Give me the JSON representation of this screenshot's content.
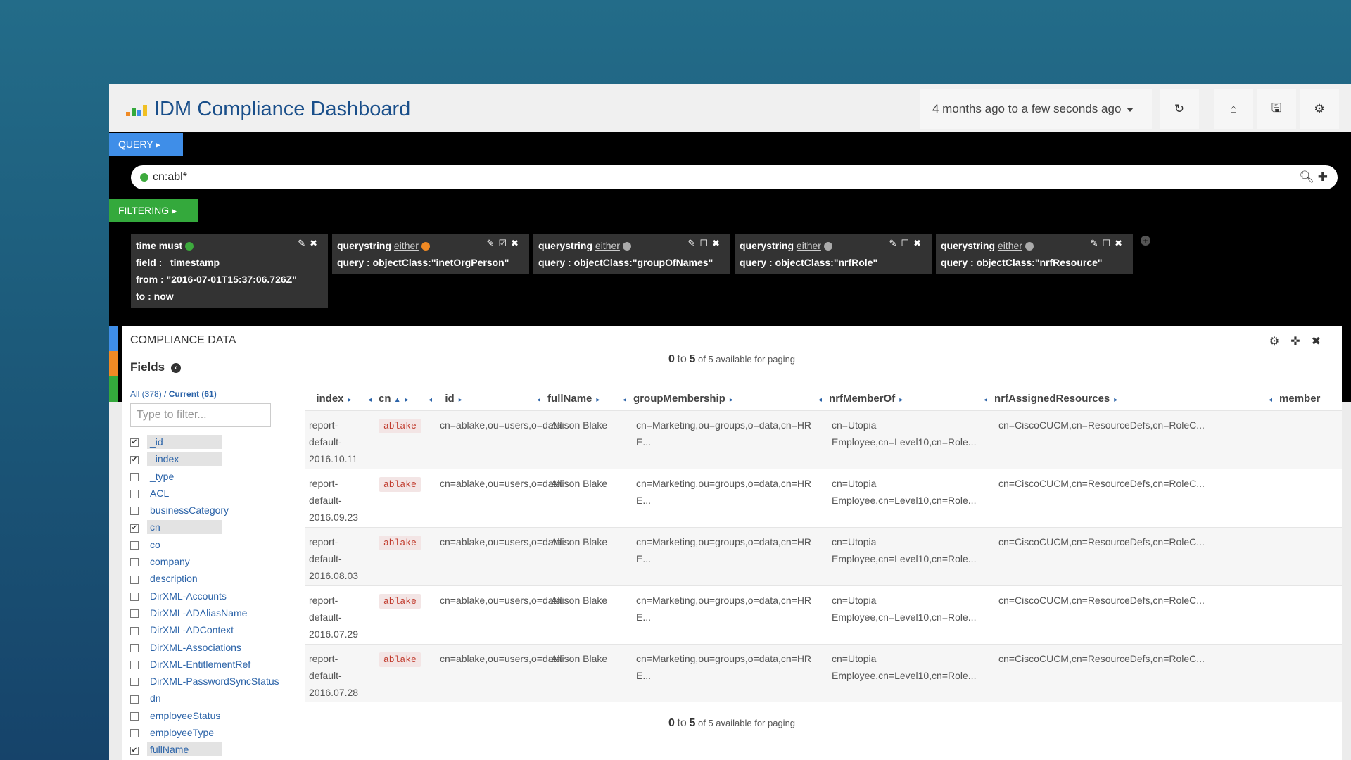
{
  "header": {
    "title": "IDM Compliance Dashboard",
    "time_range": "4 months ago to a few seconds ago"
  },
  "query": {
    "tab_label": "QUERY",
    "value": "cn:abl*"
  },
  "filtering": {
    "tab_label": "FILTERING",
    "filters": [
      {
        "type": "time",
        "mode": "must",
        "dot_color": "#3daa3d",
        "lines": [
          "field : _timestamp",
          "from : \"2016-07-01T15:37:06.726Z\"",
          "to : now"
        ]
      },
      {
        "type": "querystring",
        "mode": "either",
        "dot_color": "#f08a24",
        "lines": [
          "query : objectClass:\"inetOrgPerson\""
        ]
      },
      {
        "type": "querystring",
        "mode": "either",
        "dot_color": "#aaaaaa",
        "lines": [
          "query : objectClass:\"groupOfNames\""
        ]
      },
      {
        "type": "querystring",
        "mode": "either",
        "dot_color": "#aaaaaa",
        "lines": [
          "query : objectClass:\"nrfRole\""
        ]
      },
      {
        "type": "querystring",
        "mode": "either",
        "dot_color": "#aaaaaa",
        "lines": [
          "query : objectClass:\"nrfResource\""
        ]
      }
    ]
  },
  "panel": {
    "title": "COMPLIANCE DATA",
    "fields_title": "Fields",
    "fields_all": "All (378)",
    "fields_current": "Current (61)",
    "filter_placeholder": "Type to filter...",
    "fields": [
      {
        "name": "_id",
        "checked": true
      },
      {
        "name": "_index",
        "checked": true
      },
      {
        "name": "_type",
        "checked": false
      },
      {
        "name": "ACL",
        "checked": false
      },
      {
        "name": "businessCategory",
        "checked": false
      },
      {
        "name": "cn",
        "checked": true
      },
      {
        "name": "co",
        "checked": false
      },
      {
        "name": "company",
        "checked": false
      },
      {
        "name": "description",
        "checked": false
      },
      {
        "name": "DirXML-Accounts",
        "checked": false
      },
      {
        "name": "DirXML-ADAliasName",
        "checked": false
      },
      {
        "name": "DirXML-ADContext",
        "checked": false
      },
      {
        "name": "DirXML-Associations",
        "checked": false
      },
      {
        "name": "DirXML-EntitlementRef",
        "checked": false
      },
      {
        "name": "DirXML-PasswordSyncStatus",
        "checked": false
      },
      {
        "name": "dn",
        "checked": false
      },
      {
        "name": "employeeStatus",
        "checked": false
      },
      {
        "name": "employeeType",
        "checked": false
      },
      {
        "name": "fullName",
        "checked": true
      }
    ],
    "paging": {
      "from": "0",
      "to_word": "to",
      "to": "5",
      "suffix": "of 5 available for paging"
    },
    "columns": [
      "_index",
      "cn",
      "_id",
      "fullName",
      "groupMembership",
      "nrfMemberOf",
      "nrfAssignedResources",
      "member"
    ],
    "rows": [
      {
        "index": "report-default-2016.10.11",
        "cn": "ablake",
        "id": "cn=ablake,ou=users,o=data",
        "fullName": "Allison Blake",
        "groupMembership": "cn=Marketing,ou=groups,o=data,cn=HR E...",
        "nrfMemberOf": "cn=Utopia Employee,cn=Level10,cn=Role...",
        "nrfAssignedResources": "cn=CiscoCUCM,cn=ResourceDefs,cn=RoleC..."
      },
      {
        "index": "report-default-2016.09.23",
        "cn": "ablake",
        "id": "cn=ablake,ou=users,o=data",
        "fullName": "Allison Blake",
        "groupMembership": "cn=Marketing,ou=groups,o=data,cn=HR E...",
        "nrfMemberOf": "cn=Utopia Employee,cn=Level10,cn=Role...",
        "nrfAssignedResources": "cn=CiscoCUCM,cn=ResourceDefs,cn=RoleC..."
      },
      {
        "index": "report-default-2016.08.03",
        "cn": "ablake",
        "id": "cn=ablake,ou=users,o=data",
        "fullName": "Allison Blake",
        "groupMembership": "cn=Marketing,ou=groups,o=data,cn=HR E...",
        "nrfMemberOf": "cn=Utopia Employee,cn=Level10,cn=Role...",
        "nrfAssignedResources": "cn=CiscoCUCM,cn=ResourceDefs,cn=RoleC..."
      },
      {
        "index": "report-default-2016.07.29",
        "cn": "ablake",
        "id": "cn=ablake,ou=users,o=data",
        "fullName": "Allison Blake",
        "groupMembership": "cn=Marketing,ou=groups,o=data,cn=HR E...",
        "nrfMemberOf": "cn=Utopia Employee,cn=Level10,cn=Role...",
        "nrfAssignedResources": "cn=CiscoCUCM,cn=ResourceDefs,cn=RoleC..."
      },
      {
        "index": "report-default-2016.07.28",
        "cn": "ablake",
        "id": "cn=ablake,ou=users,o=data",
        "fullName": "Allison Blake",
        "groupMembership": "cn=Marketing,ou=groups,o=data,cn=HR E...",
        "nrfMemberOf": "cn=Utopia Employee,cn=Level10,cn=Role...",
        "nrfAssignedResources": "cn=CiscoCUCM,cn=ResourceDefs,cn=RoleC..."
      }
    ]
  },
  "colors": {
    "query_tab": "#3f8ee8",
    "filter_tab": "#34a93c",
    "title": "#1a4f8a",
    "link": "#2b63a8",
    "strip": [
      "#3f8ee8",
      "#f08a24",
      "#34a93c"
    ]
  },
  "icons": {
    "logo": "bar-chart-logo-icon",
    "refresh": "refresh-icon",
    "home": "home-icon",
    "save": "save-icon",
    "settings": "gear-icon",
    "search": "search-icon",
    "add": "plus-icon",
    "edit": "edit-icon",
    "toggle": "checkbox-icon",
    "remove": "close-icon",
    "move": "move-icon",
    "back": "chevron-left-icon"
  }
}
